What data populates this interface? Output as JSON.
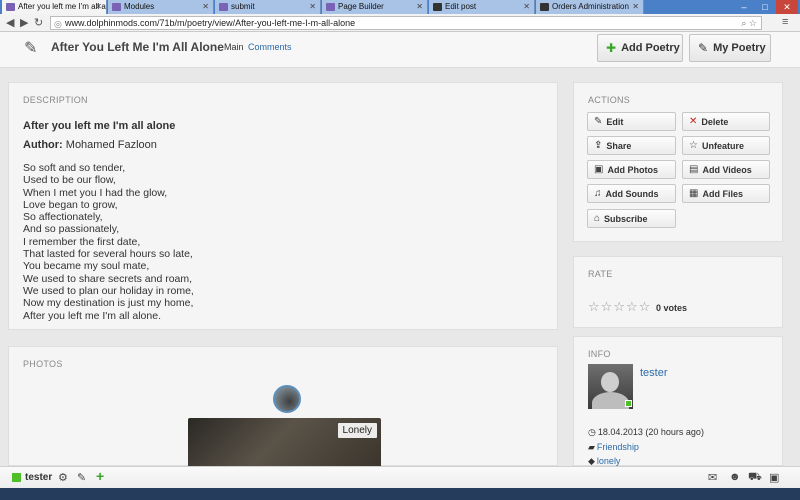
{
  "browser": {
    "tabs": [
      {
        "title": "After you left me I'm all al",
        "active": true
      },
      {
        "title": "Modules",
        "active": false
      },
      {
        "title": "submit",
        "active": false
      },
      {
        "title": "Page Builder",
        "active": false
      },
      {
        "title": "Edit post",
        "active": false
      },
      {
        "title": "Orders Administration",
        "active": false
      }
    ],
    "url": "www.dolphinmods.com/71b/m/poetry/view/After-you-left-me-I-m-all-alone"
  },
  "header": {
    "title": "After You Left Me I'm All Alone",
    "link_main": "Main",
    "link_comments": "Comments",
    "add_poetry": "Add Poetry",
    "my_poetry": "My Poetry"
  },
  "description": {
    "section_title": "DESCRIPTION",
    "heading": "After you left me I'm all alone",
    "author_label": "Author:",
    "author_name": "Mohamed Fazloon",
    "lines": [
      "So soft and so tender,",
      "Used to be our flow,",
      "When I met you I had the glow,",
      "Love began to grow,",
      "So affectionately,",
      "And so passionately,",
      "I remember the first date,",
      "That lasted for several hours so late,",
      "You became my soul mate,",
      "We used to share secrets and roam,",
      "We used to plan our holiday in rome,",
      "Now my destination is just my home,",
      "After you left me I'm all alone."
    ]
  },
  "photos": {
    "section_title": "PHOTOS",
    "photo_label": "Lonely"
  },
  "actions": {
    "section_title": "ACTIONS",
    "buttons": [
      "Edit",
      "Delete",
      "Share",
      "Unfeature",
      "Add Photos",
      "Add Videos",
      "Add Sounds",
      "Add Files",
      "Subscribe"
    ]
  },
  "rate": {
    "section_title": "RATE",
    "votes": "0 votes",
    "rating": 0,
    "max": 5
  },
  "info": {
    "section_title": "INFO",
    "username": "tester",
    "date": "18.04.2013 (20 hours ago)",
    "category": "Friendship",
    "tag": "lonely"
  },
  "bottombar": {
    "username": "tester"
  }
}
